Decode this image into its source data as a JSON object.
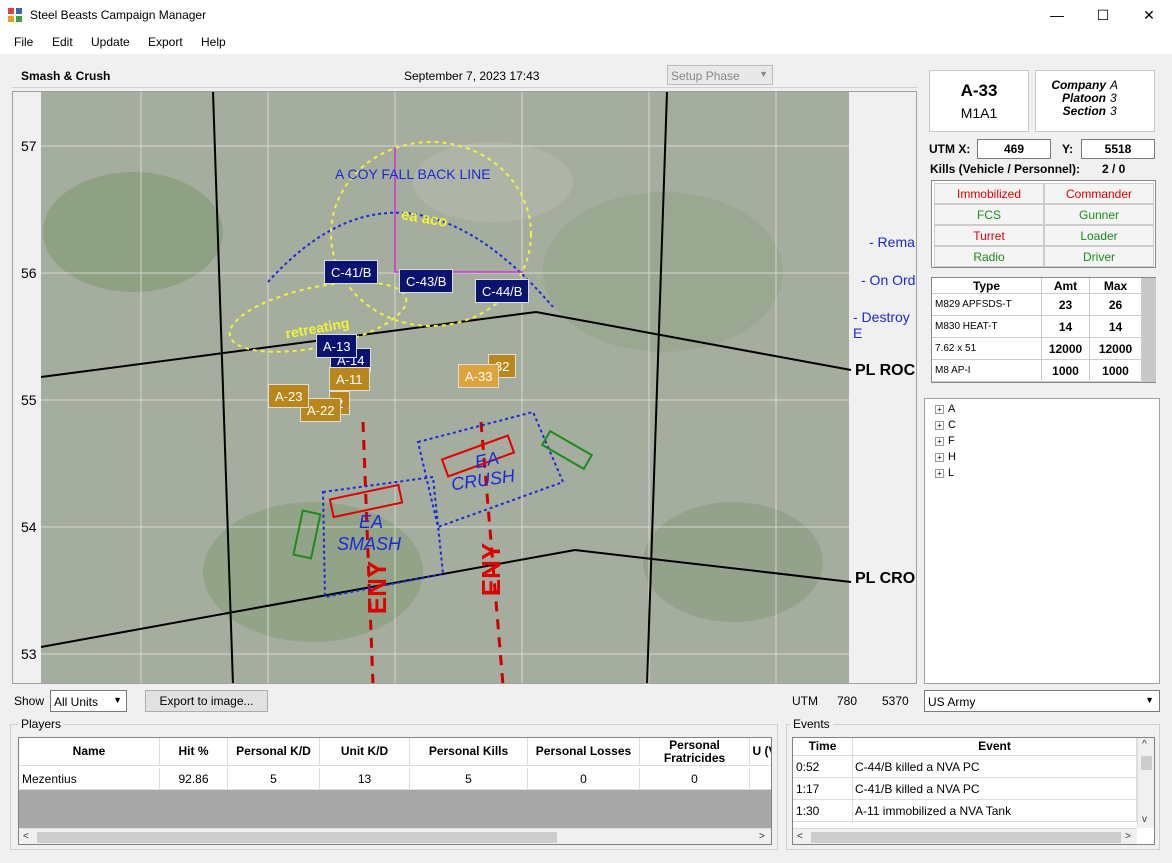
{
  "window": {
    "title": "Steel Beasts Campaign Manager",
    "minimize": "—",
    "maximize": "☐",
    "close": "✕"
  },
  "menu": [
    "File",
    "Edit",
    "Update",
    "Export",
    "Help"
  ],
  "header": {
    "scenario": "Smash & Crush",
    "datetime": "September 7, 2023 17:43",
    "phase": "Setup Phase"
  },
  "map": {
    "grid_labels": [
      "57",
      "56",
      "55",
      "54",
      "53"
    ],
    "phase_lines": [
      "PL ROC",
      "PL CRO"
    ],
    "annotations": {
      "fall_back": "A COY FALL BACK LINE",
      "ea_aco": "ea aco",
      "retreating": "retreating",
      "remain": "- Rema",
      "on_orders": "- On Ord",
      "destroy": "- Destroy E",
      "ea_crush_1": "EA",
      "ea_crush_2": "CRUSH",
      "ea_smash_1": "EA",
      "ea_smash_2": "SMASH",
      "enemy_1": "ENY",
      "enemy_2": "ENY"
    },
    "units_blue": [
      "C-41/B",
      "C-43/B",
      "C-44/B",
      "A-13",
      "A-14"
    ],
    "units_gold": [
      "A-11",
      "A-23",
      "2",
      "A-22",
      "A-33",
      "32"
    ]
  },
  "unit_info": {
    "callsign": "A-33",
    "vehicle": "M1A1",
    "company_label": "Company",
    "company": "A",
    "platoon_label": "Platoon",
    "platoon": "3",
    "section_label": "Section",
    "section": "3",
    "utm_x_label": "UTM X:",
    "utm_x": "469",
    "y_label": "Y:",
    "utm_y": "5518",
    "kills_label": "Kills (Vehicle / Personnel):",
    "kills": "2 / 0"
  },
  "damage": [
    {
      "label": "Immobilized",
      "color": "#e00000"
    },
    {
      "label": "Commander",
      "color": "#e00000"
    },
    {
      "label": "FCS",
      "color": "#1a8c1a"
    },
    {
      "label": "Gunner",
      "color": "#1a8c1a"
    },
    {
      "label": "Turret",
      "color": "#e00000"
    },
    {
      "label": "Loader",
      "color": "#1a8c1a"
    },
    {
      "label": "Radio",
      "color": "#1a8c1a"
    },
    {
      "label": "Driver",
      "color": "#1a8c1a"
    }
  ],
  "ammo": {
    "headers": [
      "Type",
      "Amt",
      "Max"
    ],
    "rows": [
      [
        "M829 APFSDS-T",
        "23",
        "26"
      ],
      [
        "M830 HEAT-T",
        "14",
        "14"
      ],
      [
        "7.62 x 51",
        "12000",
        "12000"
      ],
      [
        "M8 AP-I",
        "1000",
        "1000"
      ]
    ]
  },
  "tree": [
    "A",
    "C",
    "F",
    "H",
    "L"
  ],
  "toolbar": {
    "show_label": "Show",
    "show_value": "All Units",
    "export_button": "Export to image...",
    "utm_label": "UTM",
    "utm_x": "780",
    "utm_y": "5370",
    "army": "US Army"
  },
  "players": {
    "title": "Players",
    "headers": [
      "Name",
      "Hit %",
      "Personal K/D",
      "Unit K/D",
      "Personal Kills",
      "Personal Losses",
      "Personal Fratricides",
      "U (V"
    ],
    "rows": [
      [
        "Mezentius",
        "92.86",
        "5",
        "13",
        "5",
        "0",
        "0",
        ""
      ]
    ]
  },
  "events": {
    "title": "Events",
    "headers": [
      "Time",
      "Event"
    ],
    "rows": [
      [
        "0:52",
        "C-44/B killed a NVA PC"
      ],
      [
        "1:17",
        "C-41/B killed a NVA PC"
      ],
      [
        "1:30",
        "A-11 immobilized a NVA Tank"
      ]
    ]
  },
  "colors": {
    "unit_blue": "#0a1470",
    "unit_gold": "#b8861b",
    "kill_red": "#e00000",
    "ok_green": "#1a8c1a"
  }
}
